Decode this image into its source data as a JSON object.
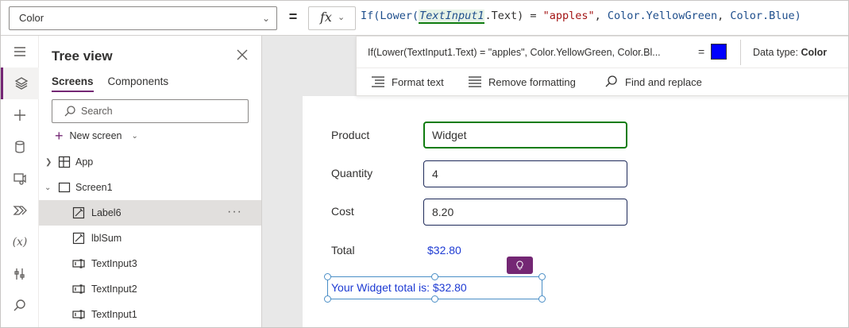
{
  "formula_bar": {
    "property": "Color",
    "equals": "=",
    "fx": "fx",
    "formula": {
      "t1": "If(",
      "t2": "Lower(",
      "t3": "TextInput1",
      "t4": ".Text",
      "t5": ") = ",
      "t6": "\"apples\"",
      "t7": ", ",
      "t8": "Color.YellowGreen",
      "t9": ", ",
      "t10": "Color.Blue",
      "t11": ")"
    }
  },
  "formula_popup": {
    "preview": "If(Lower(TextInput1.Text) = \"apples\", Color.YellowGreen, Color.Bl...",
    "equals": "=",
    "swatch_color": "#0000ff",
    "data_type_label": "Data type:",
    "data_type_value": "Color",
    "tools": {
      "format_text": "Format text",
      "remove_formatting": "Remove formatting",
      "find_replace": "Find and replace"
    }
  },
  "tree": {
    "title": "Tree view",
    "tabs": {
      "screens": "Screens",
      "components": "Components"
    },
    "search_placeholder": "Search",
    "new_screen": "New screen",
    "items": {
      "app": "App",
      "screen1": "Screen1",
      "label6": "Label6",
      "lblsum": "lblSum",
      "textinput3": "TextInput3",
      "textinput2": "TextInput2",
      "textinput1": "TextInput1"
    },
    "more": "···"
  },
  "form": {
    "product_label": "Product",
    "product_value": "Widget",
    "quantity_label": "Quantity",
    "quantity_value": "4",
    "cost_label": "Cost",
    "cost_value": "8.20",
    "total_label": "Total",
    "total_value": "$32.80",
    "summary": "Your Widget total is: $32.80"
  },
  "colors": {
    "accent": "#742774",
    "focus": "#107c10",
    "label_text": "#1e3bd3"
  }
}
